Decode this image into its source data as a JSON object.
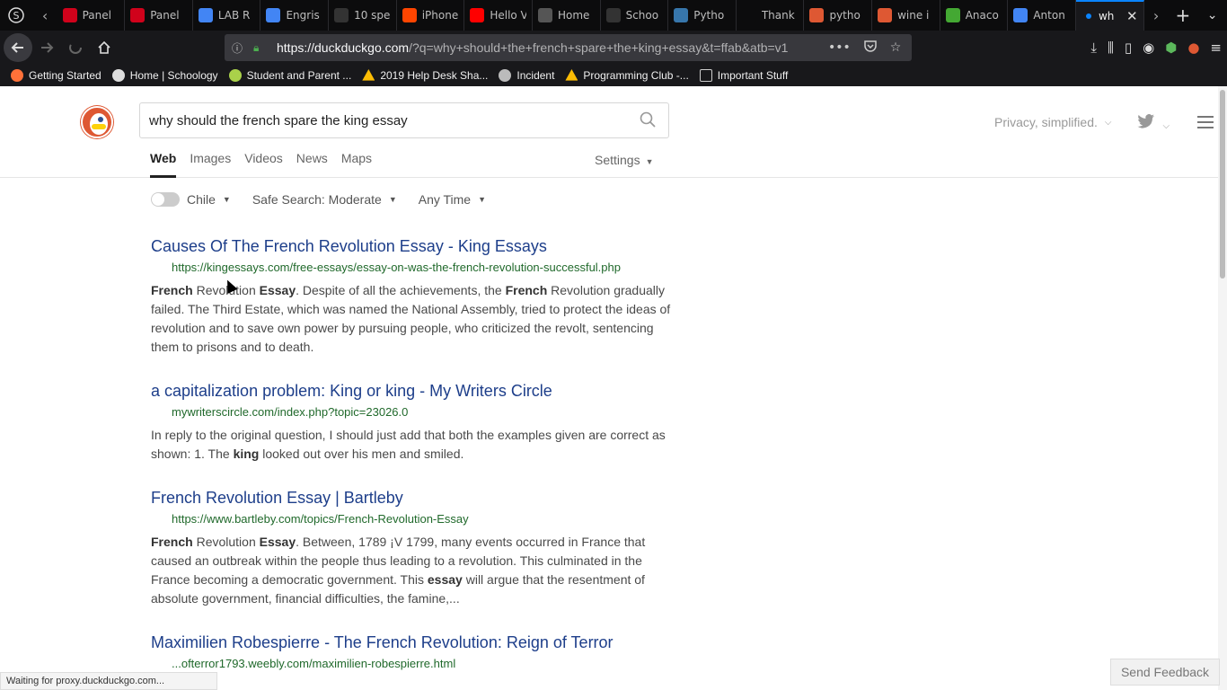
{
  "browser": {
    "tabs": [
      {
        "label": "",
        "icon": "skype-icon",
        "color": "#444",
        "kind": "special"
      },
      {
        "label": "Panel",
        "icon": "pdf-icon",
        "color": "#d0021b"
      },
      {
        "label": "Panel",
        "icon": "pdf-icon",
        "color": "#d0021b"
      },
      {
        "label": "LAB R",
        "icon": "docs-icon",
        "color": "#4285f4"
      },
      {
        "label": "Engris",
        "icon": "docs-icon",
        "color": "#4285f4"
      },
      {
        "label": "10 spe",
        "icon": "site-icon",
        "color": "#333"
      },
      {
        "label": "iPhone",
        "icon": "reddit-icon",
        "color": "#ff4500"
      },
      {
        "label": "Hello V",
        "icon": "youtube-icon",
        "color": "#ff0000"
      },
      {
        "label": "Home",
        "icon": "schoology-icon",
        "color": "#555"
      },
      {
        "label": "Schoo",
        "icon": "loading-icon",
        "color": "#333"
      },
      {
        "label": "Pytho",
        "icon": "python-icon",
        "color": "#3776ab"
      },
      {
        "label": "Thank",
        "icon": "blank-icon",
        "color": "#0c0c0d"
      },
      {
        "label": "pytho",
        "icon": "duckduckgo-icon",
        "color": "#de5833"
      },
      {
        "label": "wine i",
        "icon": "duckduckgo-icon",
        "color": "#de5833"
      },
      {
        "label": "Anaco",
        "icon": "loading-icon",
        "color": "#44a833"
      },
      {
        "label": "Anton",
        "icon": "docs-icon",
        "color": "#4285f4"
      },
      {
        "label": "wh",
        "icon": "loading-dot-icon",
        "color": "#0a84ff",
        "active": true
      }
    ],
    "url_host": "https://duckduckgo.com",
    "url_rest": "/?q=why+should+the+french+spare+the+king+essay&t=ffab&atb=v1",
    "bookmarks": [
      {
        "label": "Getting Started",
        "icon": "firefox-icon",
        "color": "#ff7139"
      },
      {
        "label": "Home | Schoology",
        "icon": "schoology-icon",
        "color": "#dddddd"
      },
      {
        "label": "Student and Parent ...",
        "icon": "bookmark-p-icon",
        "color": "#aad14a"
      },
      {
        "label": "2019 Help Desk Sha...",
        "icon": "drive-icon",
        "color": "#fbbc04"
      },
      {
        "label": "Incident",
        "icon": "globe-icon",
        "color": "#bbbbbb"
      },
      {
        "label": "Programming Club -...",
        "icon": "drive-icon",
        "color": "#fbbc04"
      },
      {
        "label": "Important Stuff",
        "icon": "folder-icon",
        "color": "#cccccc"
      }
    ],
    "status_text": "Waiting for proxy.duckduckgo.com..."
  },
  "search": {
    "query": "why should the french spare the king essay",
    "tagline": "Privacy, simplified.",
    "tabs": [
      "Web",
      "Images",
      "Videos",
      "News",
      "Maps"
    ],
    "active_tab": "Web",
    "settings_label": "Settings",
    "region": "Chile",
    "safe_search": "Safe Search: Moderate",
    "time": "Any Time"
  },
  "results": [
    {
      "title": "Causes Of The French Revolution Essay - King Essays",
      "url": "https://kingessays.com/free-essays/essay-on-was-the-french-revolution-successful.php",
      "snippet_html": "<b>French</b> Revolution <b>Essay</b>. Despite of all the achievements, the <b>French</b> Revolution gradually failed. The Third Estate, which was named the National Assembly, tried to protect the ideas of revolution and to save own power by pursuing people, who criticized the revolt, sentencing them to prisons and to death."
    },
    {
      "title": "a capitalization problem: King or king - My Writers Circle",
      "url": "mywriterscircle.com/index.php?topic=23026.0",
      "snippet_html": "In reply to the original question, I should just add that both the examples given are correct as shown: 1. The <b>king</b> looked out over his men and smiled."
    },
    {
      "title": "French Revolution Essay | Bartleby",
      "url": "https://www.bartleby.com/topics/French-Revolution-Essay",
      "snippet_html": "<b>French</b> Revolution <b>Essay</b>. Between, 1789 ¡V 1799, many events occurred in France that caused an outbreak within the people thus leading to a revolution. This culminated in the France becoming a democratic government. This <b>essay</b> will argue that the resentment of absolute government, financial difficulties, the famine,..."
    },
    {
      "title": "Maximilien Robespierre - The French Revolution: Reign of Terror",
      "url": "...ofterror1793.weebly.com/maximilien-robespierre.html",
      "snippet_html": ""
    }
  ],
  "feedback_label": "Send Feedback"
}
